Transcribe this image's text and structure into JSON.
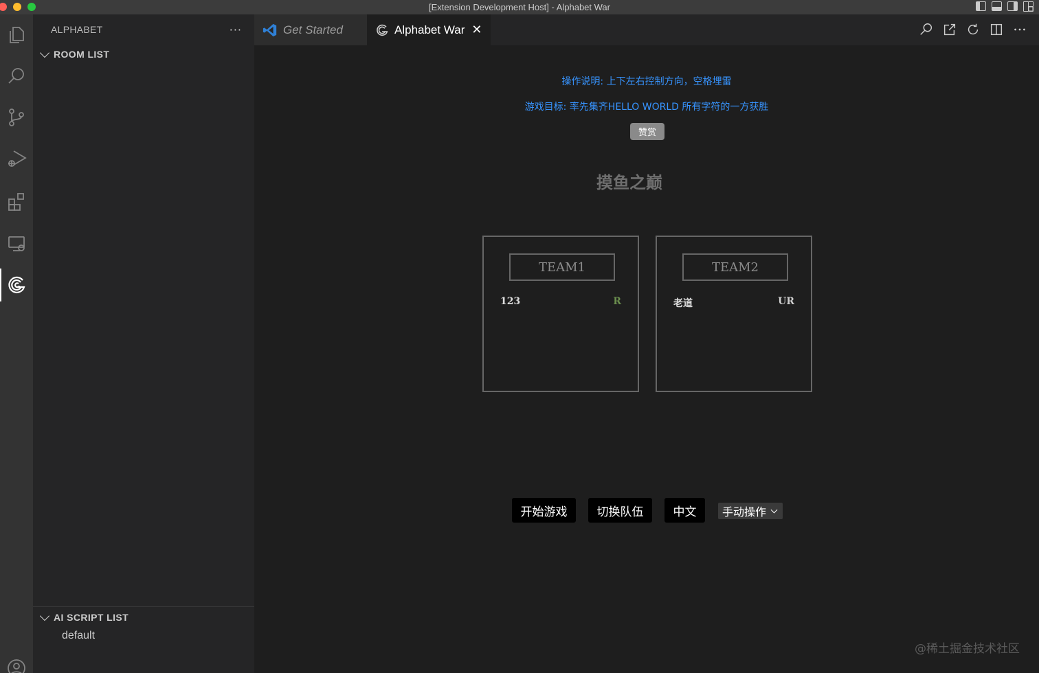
{
  "window": {
    "title": "[Extension Development Host] - Alphabet War"
  },
  "activity_bar": {
    "icons": [
      "explorer-icon",
      "search-icon",
      "source-control-icon",
      "run-debug-icon",
      "extensions-icon",
      "remote-explorer-icon",
      "alphabet-war-icon",
      "account-icon"
    ],
    "active": "alphabet-war-icon"
  },
  "sidebar": {
    "title": "ALPHABET",
    "more": "···",
    "room_section": {
      "label": "ROOM LIST"
    },
    "ai_section": {
      "label": "AI SCRIPT LIST",
      "items": [
        "default"
      ]
    }
  },
  "tabs": [
    {
      "label": "Get Started",
      "icon": "vscode-icon"
    },
    {
      "label": "Alphabet War",
      "icon": "alphabet-war-icon",
      "close": "✕"
    }
  ],
  "game": {
    "instructions": "操作说明: 上下左右控制方向，空格埋雷",
    "objective": "游戏目标: 率先集齐HELLO WORLD 所有字符的一方获胜",
    "praise_label": "赞赏",
    "title": "摸鱼之巅",
    "teams": [
      {
        "name": "TEAM1",
        "player": "123",
        "status": "R"
      },
      {
        "name": "TEAM2",
        "player": "老道",
        "status": "UR"
      }
    ],
    "controls": {
      "start_label": "开始游戏",
      "switch_label": "切换队伍",
      "lang_label": "中文",
      "mode_selected": "手动操作"
    }
  },
  "watermark": "@稀土掘金技术社区",
  "colors": {
    "accent_link": "#3794ff",
    "status_ready": "#6b8e4e"
  }
}
